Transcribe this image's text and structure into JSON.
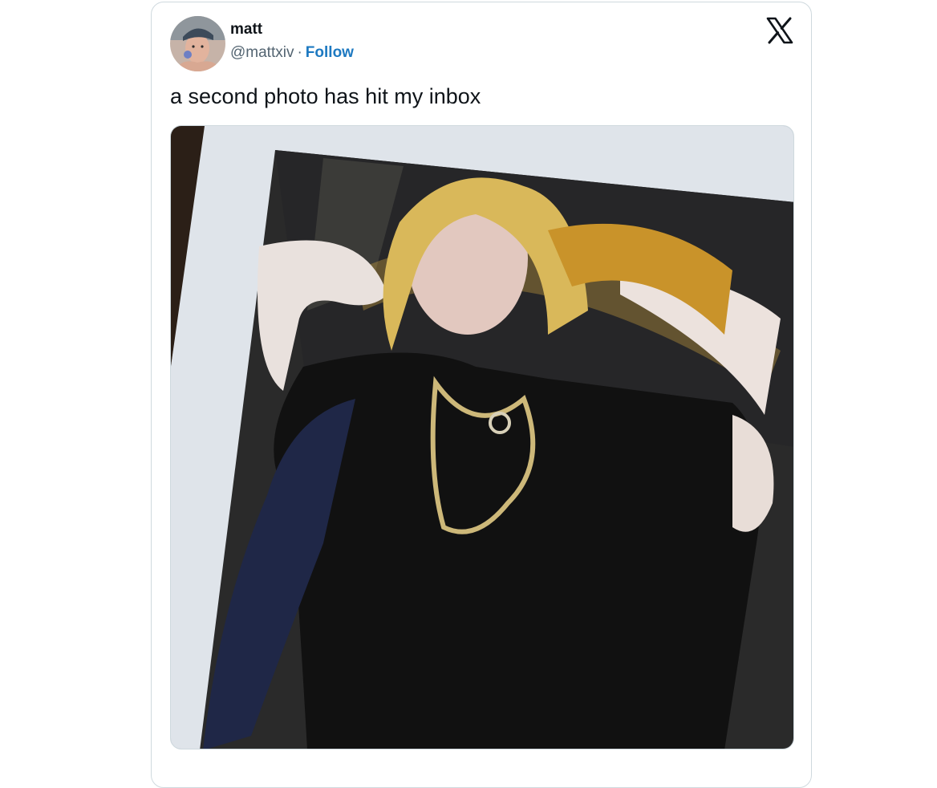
{
  "tweet": {
    "author": {
      "name": "matt",
      "handle": "@mattxiv",
      "separator": "·",
      "follow_label": "Follow"
    },
    "text": "a second photo has hit my inbox",
    "media": {
      "alt": "polaroid photo of a person in a blonde wig, black t-shirt and chain necklace"
    }
  },
  "colors": {
    "follow_link": "#1d79c1",
    "text": "#0f1419",
    "secondary": "#536471",
    "border": "#cfd9de"
  },
  "icons": {
    "brand": "x-logo-icon"
  }
}
